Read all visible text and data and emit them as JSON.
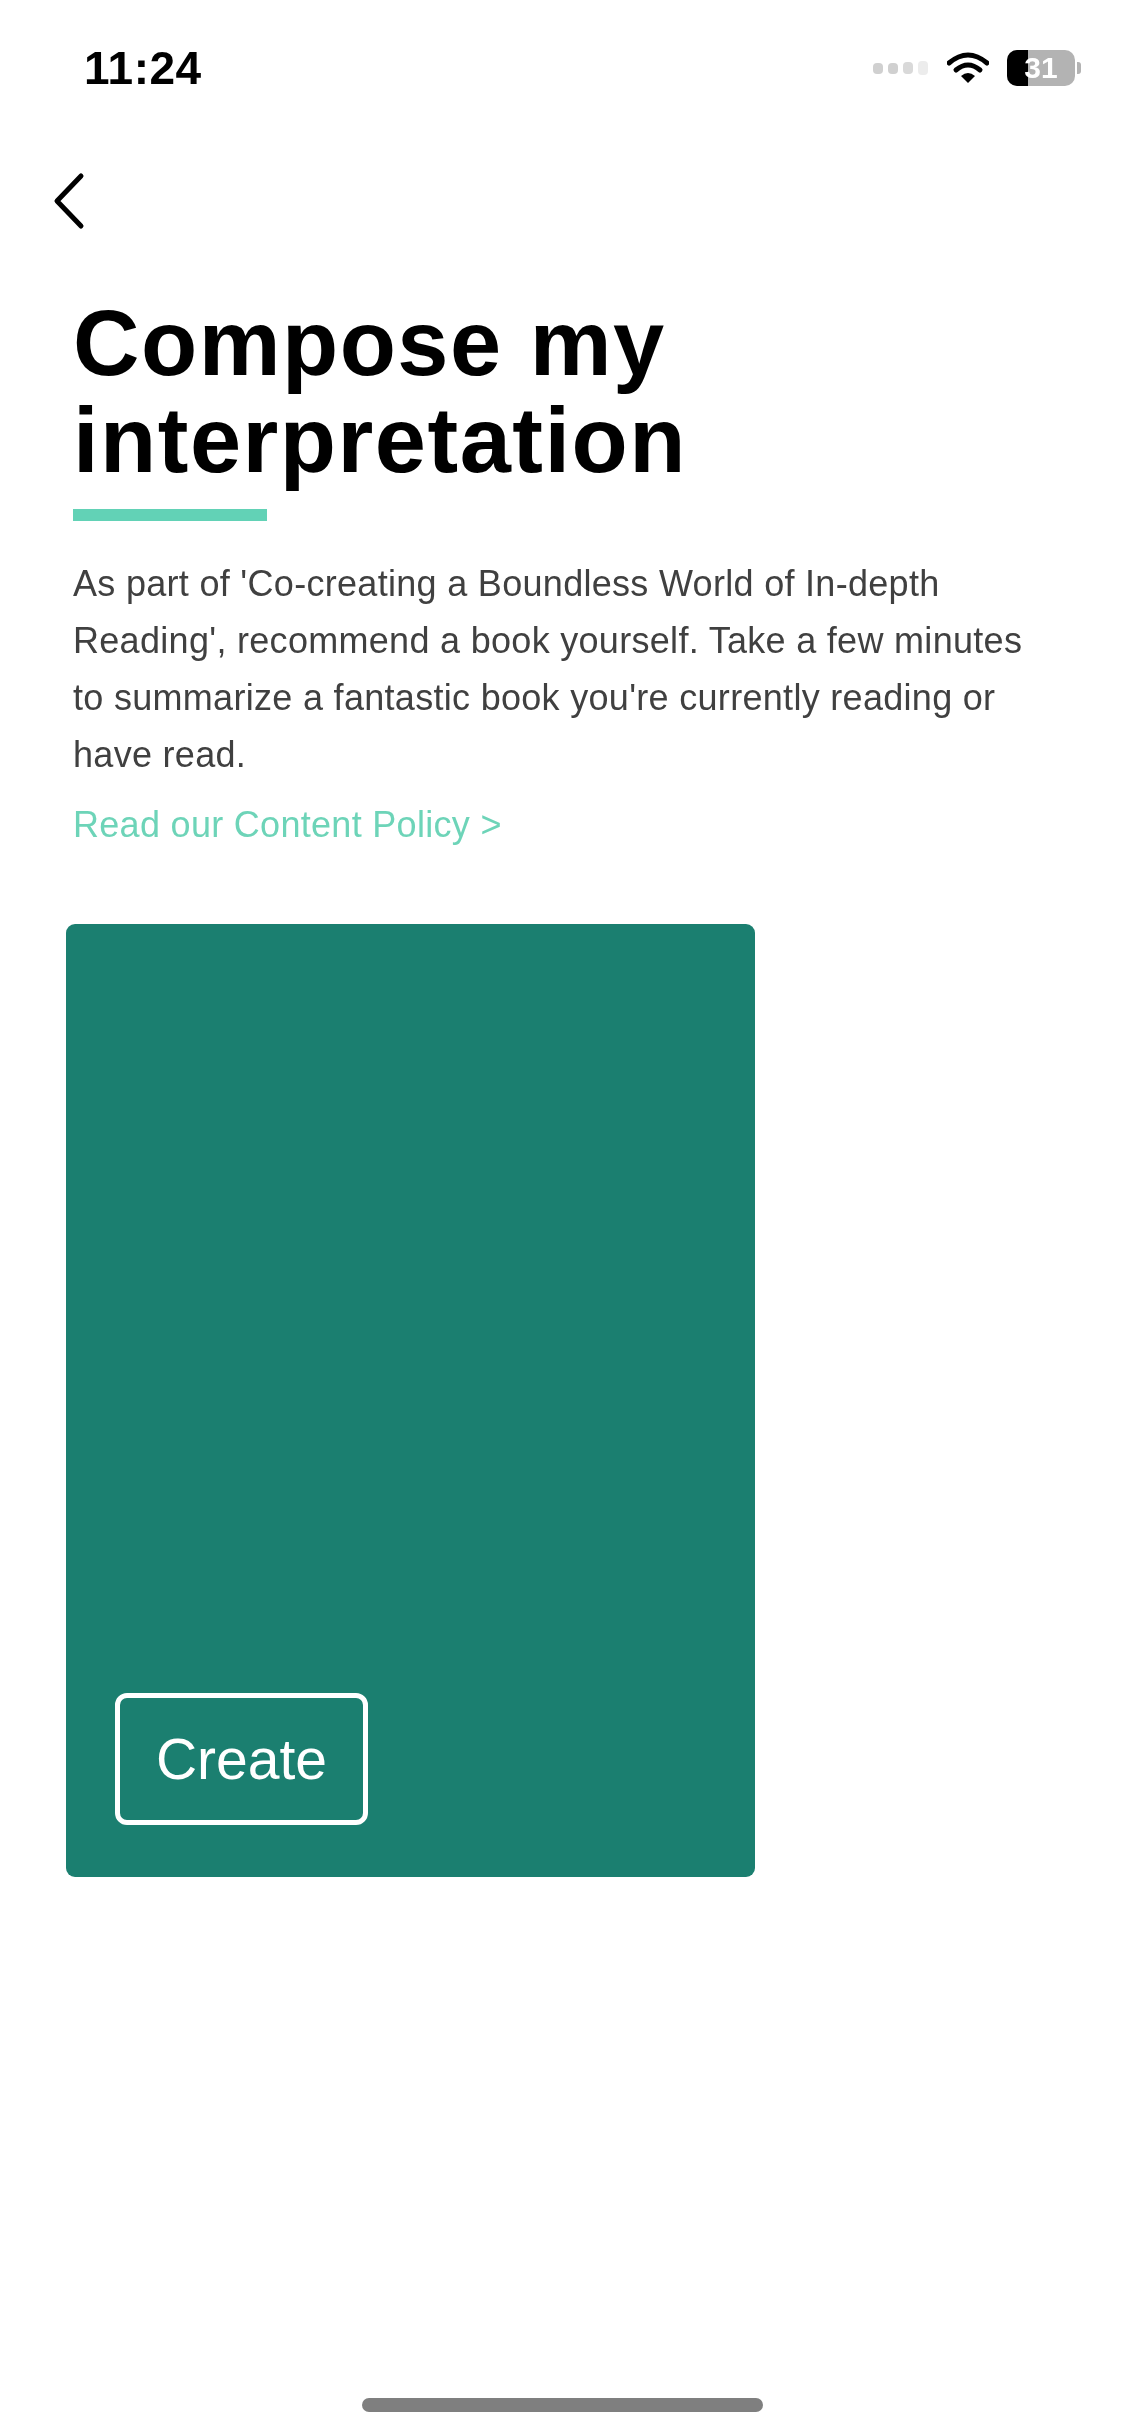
{
  "status_bar": {
    "time": "11:24",
    "battery": "31"
  },
  "title": "Compose my interpretation",
  "description": "As part of 'Co-creating a Boundless World of In-depth Reading', recommend a book yourself. Take a few minutes to summarize a fantastic book you're currently reading or have read.",
  "policy_link": "Read our Content Policy >",
  "card": {
    "button": "Create"
  }
}
